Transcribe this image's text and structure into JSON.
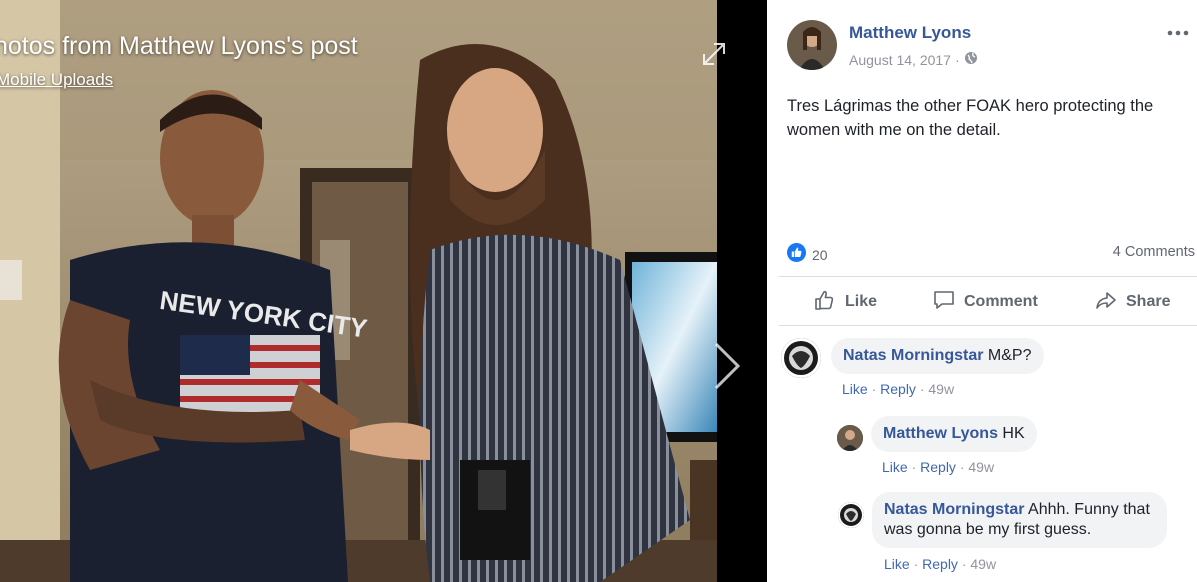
{
  "viewer": {
    "title": "hotos from Matthew Lyons's post",
    "album_link": "Mobile Uploads"
  },
  "post": {
    "author": "Matthew Lyons",
    "date": "August 14, 2017",
    "date_separator": "·",
    "privacy_icon": "globe-icon",
    "text": "Tres Lágrimas the other FOAK hero protecting the women with me on the detail.",
    "reaction_count": "20",
    "comment_count": "4 Comments",
    "actions": {
      "like": "Like",
      "comment": "Comment",
      "share": "Share"
    }
  },
  "comments": [
    {
      "author": "Natas Morningstar",
      "text": "M&P?",
      "like": "Like",
      "reply": "Reply",
      "separator": "·",
      "time": "49w"
    },
    {
      "author": "Matthew Lyons",
      "text": "HK",
      "like": "Like",
      "reply": "Reply",
      "separator": "·",
      "time": "49w"
    },
    {
      "author": "Natas Morningstar",
      "text": "Ahhh. Funny that was gonna be my first guess.",
      "like": "Like",
      "reply": "Reply",
      "separator": "·",
      "time": "49w"
    }
  ],
  "colors": {
    "link_blue": "#365899",
    "action_blue": "#4267b2",
    "like_badge": "#1877f2",
    "secondary_text": "#90949c",
    "bubble_bg": "#f2f3f5"
  }
}
